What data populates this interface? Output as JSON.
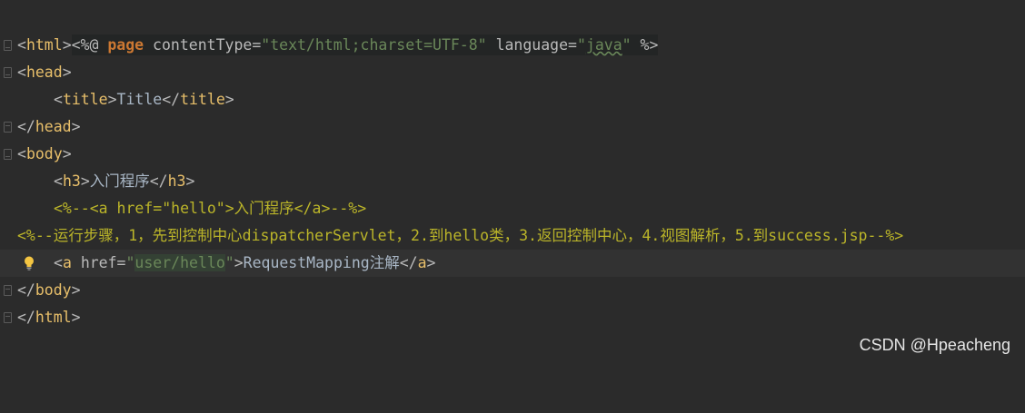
{
  "editor": {
    "lines": [
      {
        "dir_open": "<%@ ",
        "kw": "page",
        "sp1": " ",
        "attr1": "contentType=",
        "val1": "\"text/html;charset=UTF-8\"",
        "sp2": " ",
        "attr2": "language=",
        "q1": "\"",
        "val2": "java",
        "q2": "\"",
        "close": " %>"
      },
      {
        "open": "<",
        "tag": "html",
        "close": ">"
      },
      {
        "open": "<",
        "tag": "head",
        "close": ">"
      },
      {
        "o1": "<",
        "tag1": "title",
        "c1": ">",
        "text": "Title",
        "o2": "</",
        "tag2": "title",
        "c2": ">"
      },
      {
        "open": "</",
        "tag": "head",
        "close": ">"
      },
      {
        "open": "<",
        "tag": "body",
        "close": ">"
      },
      {
        "o1": "<",
        "tag1": "h3",
        "c1": ">",
        "text": "入门程序",
        "o2": "</",
        "tag2": "h3",
        "c2": ">"
      },
      {
        "comment": "<%--<a href=\"hello\">入门程序</a>--%>"
      },
      {
        "comment": "<%--运行步骤，1，先到控制中心dispatcherServlet，2.到hello类，3.返回控制中心，4.视图解析，5.到success.jsp--%>"
      },
      {
        "o1": "<",
        "tag1": "a",
        "sp": " ",
        "attr": "href=",
        "q1": "\"",
        "val": "user/hello",
        "q2": "\"",
        "c1": ">",
        "text": "RequestMapping注解",
        "o2": "</",
        "tag2": "a",
        "c2": ">"
      },
      {
        "open": "</",
        "tag": "body",
        "close": ">"
      },
      {
        "open": "</",
        "tag": "html",
        "close": ">"
      }
    ]
  },
  "watermark": "CSDN @Hpeacheng",
  "icons": {
    "intention": "lightbulb-icon",
    "fold": "fold-marker-icon"
  }
}
